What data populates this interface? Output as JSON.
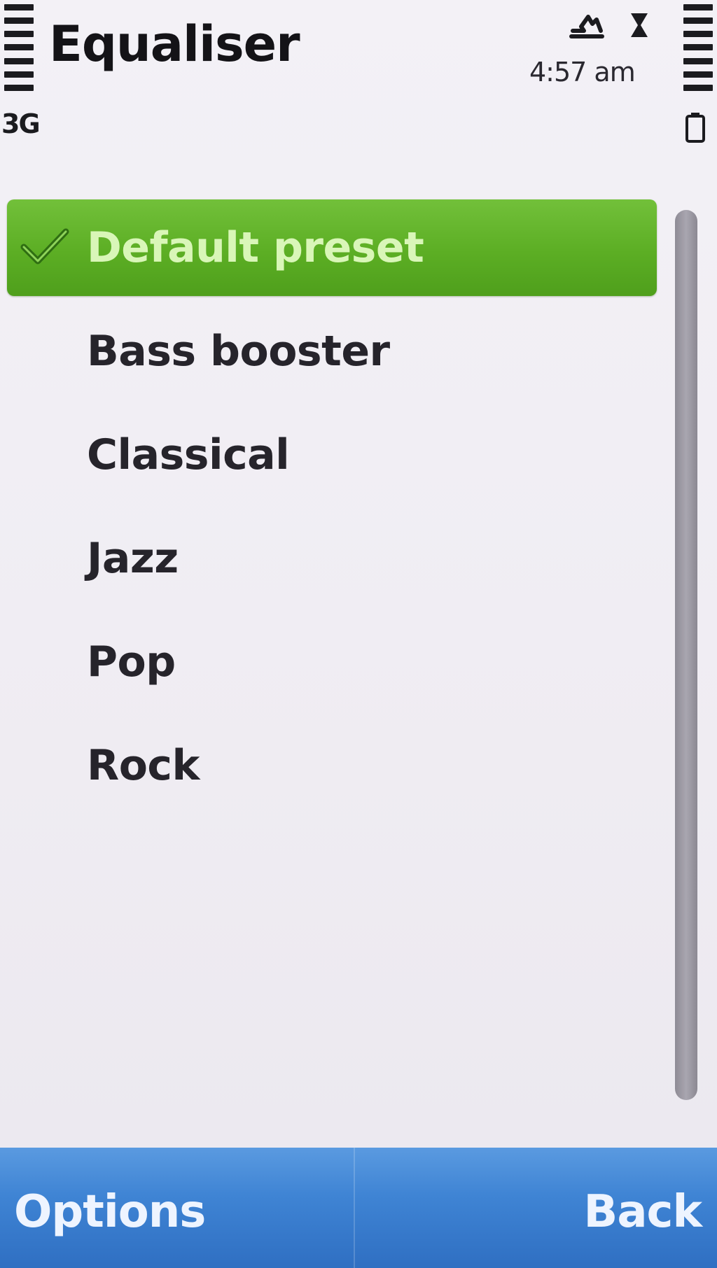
{
  "status_bar": {
    "network_label": "3G",
    "time": "4:57 am",
    "icons": [
      "bluetooth-icon",
      "hourglass-icon"
    ]
  },
  "header": {
    "title": "Equaliser"
  },
  "presets": {
    "selected_index": 0,
    "items": [
      {
        "label": "Default preset"
      },
      {
        "label": "Bass booster"
      },
      {
        "label": "Classical"
      },
      {
        "label": "Jazz"
      },
      {
        "label": "Pop"
      },
      {
        "label": "Rock"
      }
    ]
  },
  "softkeys": {
    "left_label": "Options",
    "right_label": "Back"
  },
  "colors": {
    "selection_green": "#5cae24",
    "softkey_blue": "#3f84d4",
    "background": "#f0edf3"
  }
}
